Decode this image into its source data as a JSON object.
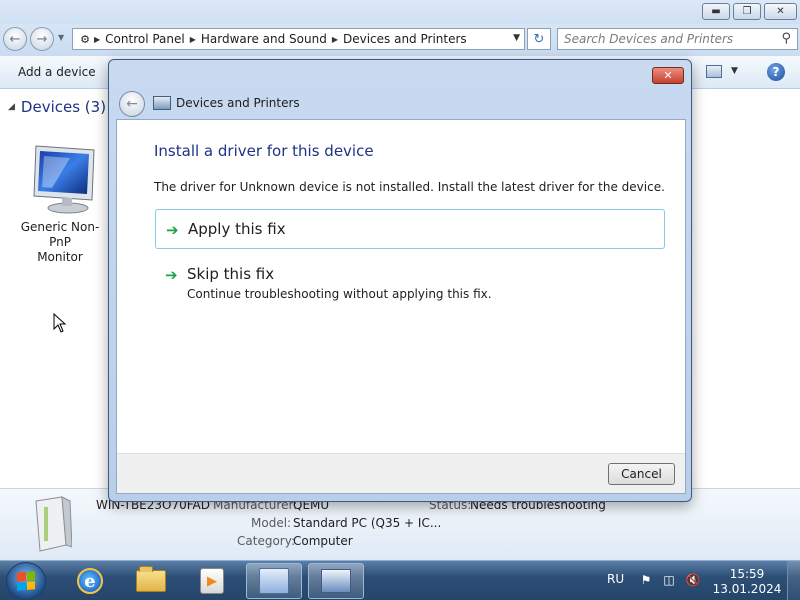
{
  "explorer": {
    "breadcrumbs": [
      "Control Panel",
      "Hardware and Sound",
      "Devices and Printers"
    ],
    "search": {
      "placeholder": "Search Devices and Printers"
    },
    "toolbar": {
      "add_device": "Add a device"
    },
    "group": {
      "label": "Devices (3)"
    },
    "device": {
      "label_line1": "Generic Non-PnP",
      "label_line2": "Monitor"
    },
    "details": {
      "name": "WIN-TBE23O70FAD",
      "manufacturer_label": "Manufacturer:",
      "manufacturer_value": "QEMU",
      "model_label": "Model:",
      "model_value": "Standard PC (Q35 + IC...",
      "category_label": "Category:",
      "category_value": "Computer",
      "status_label": "Status:",
      "status_value": "Needs troubleshooting"
    }
  },
  "dialog": {
    "title": "Devices and Printers",
    "heading": "Install a driver for this device",
    "description": "The driver for Unknown device is not installed. Install the latest driver for the device.",
    "options": [
      {
        "title": "Apply this fix",
        "subtitle": ""
      },
      {
        "title": "Skip this fix",
        "subtitle": "Continue troubleshooting without applying this fix."
      }
    ],
    "cancel_label": "Cancel"
  },
  "taskbar": {
    "language": "RU",
    "time": "15:59",
    "date": "13.01.2024"
  },
  "icons": {
    "start": "windows-flag-icon",
    "ie": "internet-explorer-icon",
    "explorer": "folder-icon",
    "media": "media-player-icon",
    "control_panel": "control-panel-icon",
    "devices": "devices-printers-icon"
  }
}
